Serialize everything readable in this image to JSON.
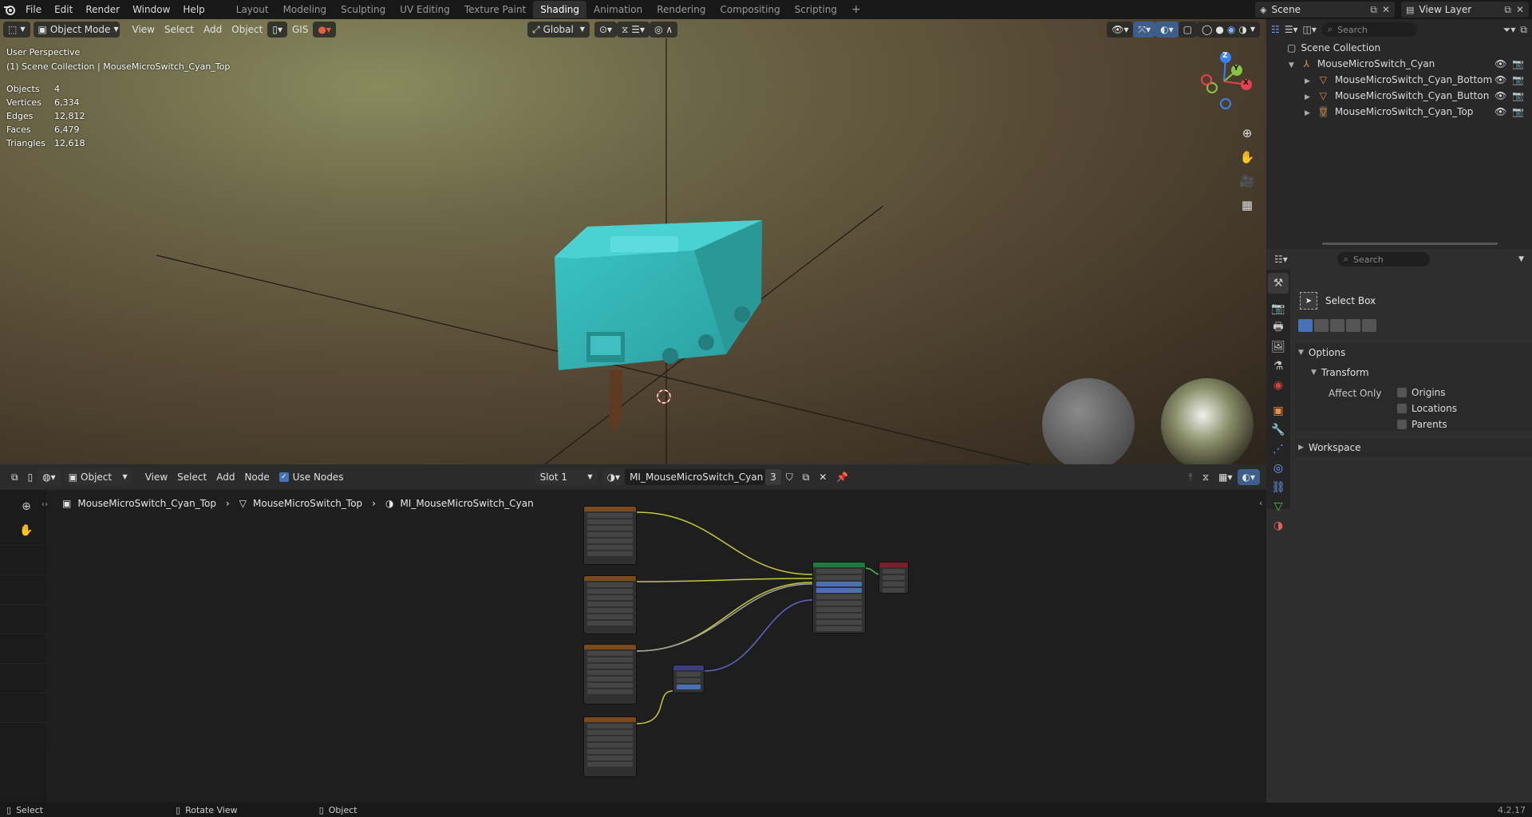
{
  "topbar": {
    "menus": [
      "File",
      "Edit",
      "Render",
      "Window",
      "Help"
    ],
    "workspaces": [
      "Layout",
      "Modeling",
      "Sculpting",
      "UV Editing",
      "Texture Paint",
      "Shading",
      "Animation",
      "Rendering",
      "Compositing",
      "Scripting"
    ],
    "active_workspace": "Shading",
    "add_tab": "+",
    "scene_name": "Scene",
    "view_layer": "View Layer"
  },
  "viewport": {
    "mode": "Object Mode",
    "menus": [
      "View",
      "Select",
      "Add",
      "Object"
    ],
    "gis": "GIS",
    "transform_orientation": "Global",
    "perspective": "User Perspective",
    "collection_path": "(1) Scene Collection | MouseMicroSwitch_Cyan_Top",
    "stats": [
      {
        "label": "Objects",
        "value": "4"
      },
      {
        "label": "Vertices",
        "value": "6,334"
      },
      {
        "label": "Edges",
        "value": "12,812"
      },
      {
        "label": "Faces",
        "value": "6,479"
      },
      {
        "label": "Triangles",
        "value": "12,618"
      }
    ],
    "gizmo": {
      "z": "Z",
      "y": "Y",
      "x": "X"
    },
    "colors": {
      "model": "#2fb5b5",
      "gizmo_x": "#e8404f",
      "gizmo_y": "#8bc34a",
      "gizmo_z": "#3b82f6"
    }
  },
  "outliner": {
    "search_placeholder": "Search",
    "root": "Scene Collection",
    "collection": "MouseMicroSwitch_Cyan",
    "objects": [
      "MouseMicroSwitch_Cyan_Bottom",
      "MouseMicroSwitch_Cyan_Button",
      "MouseMicroSwitch_Cyan_Top"
    ]
  },
  "properties": {
    "search_placeholder": "Search",
    "tool_name": "Select Box",
    "options_label": "Options",
    "transform_label": "Transform",
    "affect_only_label": "Affect Only",
    "checkboxes": [
      "Origins",
      "Locations",
      "Parents"
    ],
    "workspace_label": "Workspace"
  },
  "node_editor": {
    "object_dropdown": "Object",
    "menus": [
      "View",
      "Select",
      "Add",
      "Node"
    ],
    "use_nodes": "Use Nodes",
    "slot": "Slot 1",
    "material": "MI_MouseMicroSwitch_Cyan",
    "user_count": "3",
    "breadcrumb": [
      "MouseMicroSwitch_Cyan_Top",
      "MouseMicroSwitch_Top",
      "MI_MouseMicroSwitch_Cyan"
    ]
  },
  "statusbar": {
    "select": "Select",
    "rotate": "Rotate View",
    "object": "Object",
    "version": "4.2.17"
  }
}
